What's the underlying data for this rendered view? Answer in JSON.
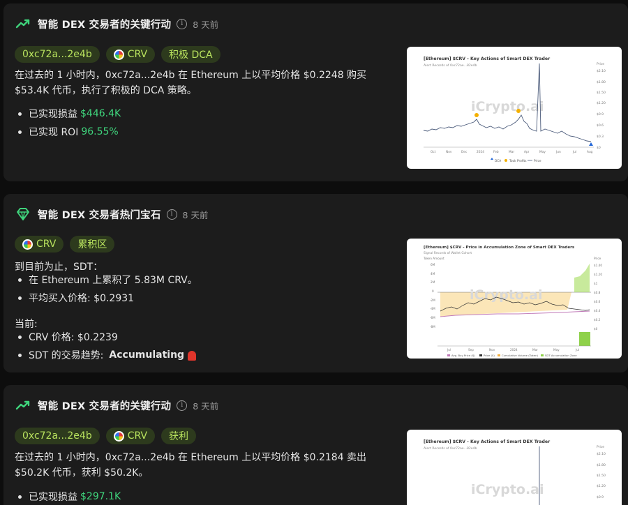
{
  "cards": [
    {
      "title": "智能 DEX 交易者的关键行动",
      "time": "8 天前",
      "tags": [
        "0xc72a...2e4b",
        "CRV",
        "积极 DCA"
      ],
      "text": "在过去的 1 小时内，0xc72a...2e4b 在 Ethereum 上以平均价格 $0.2248 购买 $53.4K 代币，执行了积极的 DCA 策略。",
      "bullets": [
        {
          "label": "已实现损益",
          "value": "$446.4K"
        },
        {
          "label": "已实现 ROI",
          "value": "96.55%"
        }
      ],
      "chart": {
        "title": "[Ethereum] $CRV - Key Actions of Smart DEX Trader",
        "subtitle": "Alert Records of 0xc72ae...82e4b",
        "watermark": "iCrypto.ai",
        "price_label": "Price",
        "y_ticks": [
          "$2.10",
          "$1.80",
          "$1.50",
          "$1.20",
          "$0.9",
          "$0.6",
          "$0.3",
          "$0"
        ],
        "x_ticks": [
          "Oct",
          "Nov",
          "Dec",
          "2024",
          "Feb",
          "Mar",
          "Apr",
          "May",
          "Jun",
          "Jul",
          "Aug"
        ],
        "legend": [
          "DCA",
          "Took Profits",
          "Price"
        ]
      }
    },
    {
      "title": "智能 DEX 交易者热门宝石",
      "time": "8 天前",
      "tags": [
        "CRV",
        "累积区"
      ],
      "intro": "到目前为止，SDT：",
      "bullets1": [
        "在 Ethereum 上累积了 5.83M CRV。",
        "平均买入价格: $0.2931"
      ],
      "now_label": "当前:",
      "bullets2": [
        {
          "label": "CRV 价格: $0.2239",
          "bold": ""
        },
        {
          "label": "SDT 的交易趋势:",
          "bold": "Accumulating"
        }
      ],
      "chart": {
        "title": "[Ethereum] $CRV - Price in Accumulation Zone of Smart DEX Traders",
        "subtitle": "Signal Records of Wallet Cohort",
        "watermark": "iCrypto.ai",
        "left_label": "Token Amount",
        "price_label": "Price",
        "left_ticks": [
          "6M",
          "4M",
          "2M",
          "0",
          "-2M",
          "-4M",
          "-6M",
          "-8M"
        ],
        "right_ticks": [
          "$1.40",
          "$1.20",
          "$1",
          "$0.8",
          "$0.6",
          "$0.4",
          "$0.2",
          "$0"
        ],
        "x_ticks": [
          "Jul",
          "Sep",
          "Nov",
          "2024",
          "Mar",
          "May",
          "Jul"
        ],
        "legend": [
          "Avg. Buy Price ($)",
          "Price ($)",
          "Cumulative Volume (Token)",
          "SDT Accumulation Zone"
        ]
      }
    },
    {
      "title": "智能 DEX 交易者的关键行动",
      "time": "8 天前",
      "tags": [
        "0xc72a...2e4b",
        "CRV",
        "获利"
      ],
      "text": "在过去的 1 小时内，0xc72a...2e4b 在 Ethereum 上以平均价格 $0.2184 卖出 $50.2K 代币，获利 $50.2K。",
      "bullets": [
        {
          "label": "已实现损益",
          "value": "$297.1K"
        }
      ],
      "chart": {
        "title": "[Ethereum] $CRV - Key Actions of Smart DEX Trader",
        "subtitle": "Alert Records of 0xc72ae...82e4b",
        "watermark": "iCrypto.ai",
        "price_label": "Price",
        "y_ticks": [
          "$2.10",
          "$1.80",
          "$1.50",
          "$1.20",
          "$0.9"
        ]
      }
    }
  ]
}
